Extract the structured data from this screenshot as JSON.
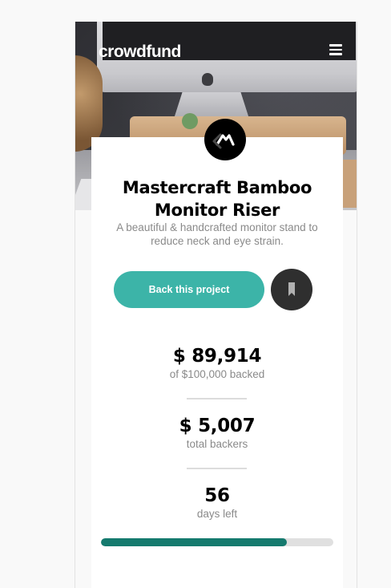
{
  "header": {
    "logo": "crowdfund",
    "menu_icon": "hamburger-icon"
  },
  "hero": {
    "image": "hero-photo-monitor-on-bamboo-riser"
  },
  "project": {
    "logo_icon": "mastercraft-logo-icon",
    "title": "Mastercraft Bamboo Monitor Riser",
    "description": "A beautiful & handcrafted monitor stand to reduce neck and eye strain."
  },
  "actions": {
    "back_label": "Back this project",
    "bookmark_icon": "bookmark-icon"
  },
  "stats": {
    "backed_value": "$ 89,914",
    "backed_label": "of $100,000 backed",
    "backers_value": "$ 5,007",
    "backers_label": "total backers",
    "days_value": "56",
    "days_label": "days left"
  },
  "progress": {
    "fraction": 0.8
  },
  "colors": {
    "accent": "#3cb4a8",
    "accent_dark": "#157a6e",
    "text": "#000000",
    "muted": "#8a8a8a"
  }
}
